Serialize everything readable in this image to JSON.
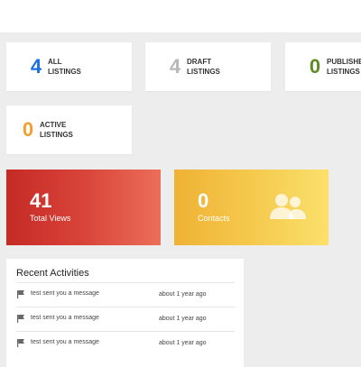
{
  "stats": [
    {
      "value": "4",
      "line1": "ALL",
      "line2": "LISTINGS",
      "color": "#1e6fe0"
    },
    {
      "value": "4",
      "line1": "DRAFT",
      "line2": "LISTINGS",
      "color": "#b8b8b8"
    },
    {
      "value": "0",
      "line1": "PUBLISHED",
      "line2": "LISTINGS",
      "color": "#5e8c24"
    },
    {
      "value": "0",
      "line1": "ACTIVE",
      "line2": "LISTINGS",
      "color": "#f0a030"
    }
  ],
  "views": {
    "value": "41",
    "label": "Total Views"
  },
  "contacts": {
    "value": "0",
    "label": "Contacts",
    "icon": "users-icon"
  },
  "recent": {
    "title": "Recent Activities",
    "items": [
      {
        "text": "test sent you a message",
        "time": "about 1 year ago",
        "icon": "flag-icon"
      },
      {
        "text": "test sent you a message",
        "time": "about 1 year ago",
        "icon": "flag-icon"
      },
      {
        "text": "test sent you a message",
        "time": "about 1 year ago",
        "icon": "flag-icon"
      }
    ]
  }
}
